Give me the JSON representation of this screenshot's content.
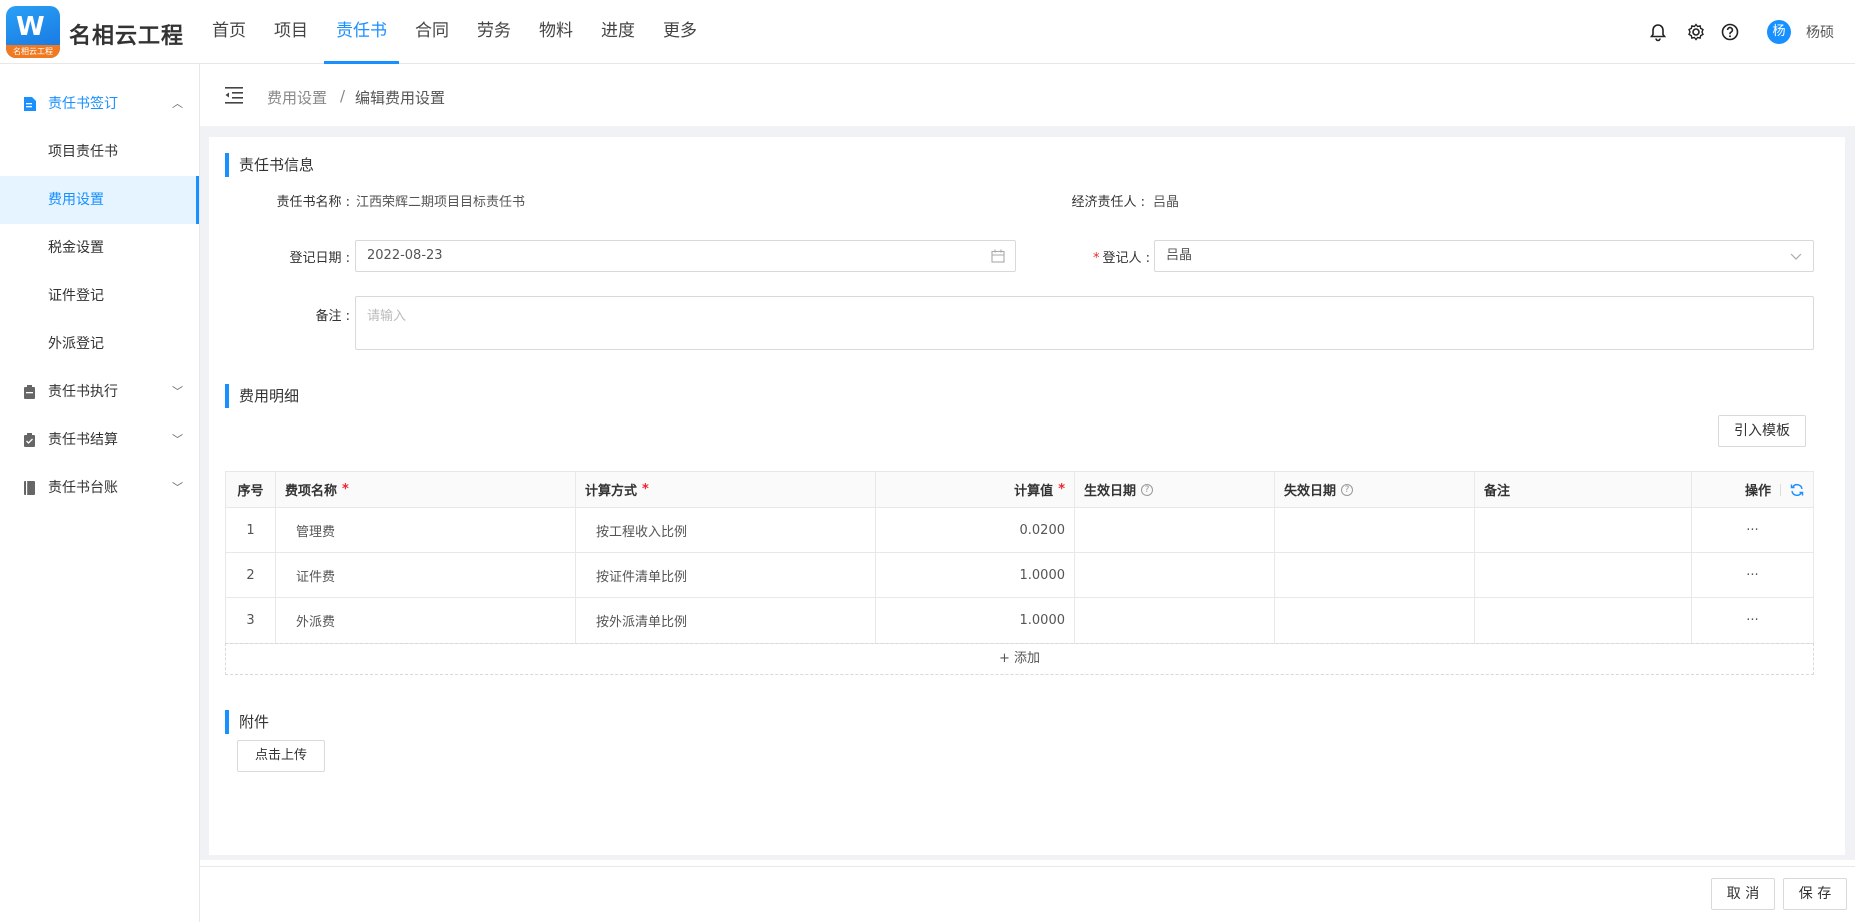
{
  "app": {
    "brand": "名相云工程",
    "logo_band_text": "名相云工程",
    "logo_glyph": "W"
  },
  "nav": [
    "首页",
    "项目",
    "责任书",
    "合同",
    "劳务",
    "物料",
    "进度",
    "更多"
  ],
  "user": {
    "avatar": "杨",
    "name": "杨硕"
  },
  "sidebar": {
    "group_sign": "责任书签订",
    "sub_items": [
      "项目责任书",
      "费用设置",
      "税金设置",
      "证件登记",
      "外派登记"
    ],
    "group_exec": "责任书执行",
    "group_settle": "责任书结算",
    "group_ledger": "责任书台账"
  },
  "breadcrumb": {
    "parent": "费用设置",
    "sep": "/",
    "current": "编辑费用设置"
  },
  "info": {
    "title": "责任书信息",
    "name_label": "责任书名称 :",
    "name_value": "江西荣辉二期项目目标责任书",
    "econ_label": "经济责任人 :",
    "econ_value": "吕晶",
    "date_label": "登记日期 :",
    "date_value": "2022-08-23",
    "req_mark": "*",
    "registrant_label": "登记人 :",
    "registrant_value": "吕晶",
    "remark_label": "备注 :",
    "remark_placeholder": "请输入"
  },
  "fees": {
    "title": "费用明细",
    "import_button": "引入模板",
    "columns": [
      "序号",
      "费项名称",
      "计算方式",
      "计算值",
      "生效日期",
      "失效日期",
      "备注",
      "操作"
    ],
    "rows": [
      {
        "index": "1",
        "name": "管理费",
        "method": "按工程收入比例",
        "value": "0.0200",
        "start": "",
        "end": "",
        "remark": "",
        "op": "···"
      },
      {
        "index": "2",
        "name": "证件费",
        "method": "按证件清单比例",
        "value": "1.0000",
        "start": "",
        "end": "",
        "remark": "",
        "op": "···"
      },
      {
        "index": "3",
        "name": "外派费",
        "method": "按外派清单比例",
        "value": "1.0000",
        "start": "",
        "end": "",
        "remark": "",
        "op": "···"
      }
    ],
    "add_label": "+ 添加"
  },
  "attachment": {
    "title": "附件",
    "upload_button": "点击上传"
  },
  "footer": {
    "cancel": "取 消",
    "save": "保 存"
  },
  "colors": {
    "accent": "#1890ff",
    "required": "#f5222d",
    "background": "#f0f2f5"
  }
}
